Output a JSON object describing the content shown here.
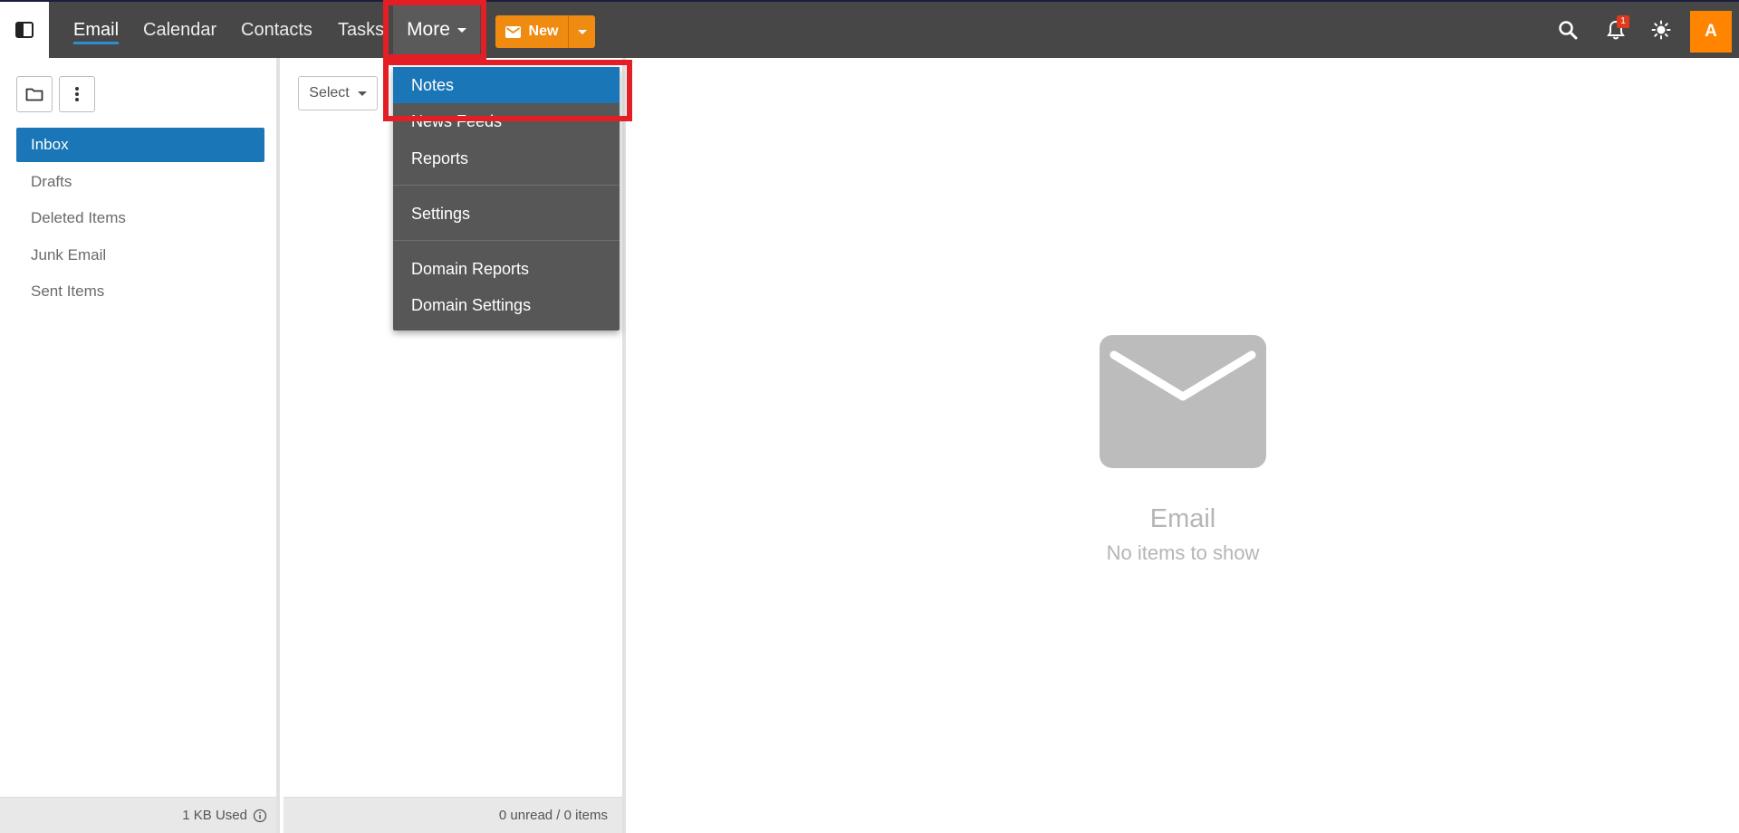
{
  "nav": {
    "tabs": [
      {
        "label": "Email",
        "active": true
      },
      {
        "label": "Calendar"
      },
      {
        "label": "Contacts"
      },
      {
        "label": "Tasks"
      }
    ],
    "more_label": "More",
    "new_label": "New",
    "notification_count": "1",
    "avatar_initial": "A",
    "icons": [
      "sidebar-toggle-icon",
      "search-icon",
      "bell-icon",
      "theme-sun-icon"
    ]
  },
  "more_menu": {
    "items": [
      "Notes",
      "News Feeds",
      "Reports",
      "Settings",
      "Domain Reports",
      "Domain Settings"
    ],
    "active_item": "Notes"
  },
  "folders": {
    "items": [
      "Inbox",
      "Drafts",
      "Deleted Items",
      "Junk Email",
      "Sent Items"
    ],
    "active": "Inbox",
    "footer": "1 KB Used"
  },
  "list": {
    "select_label": "Select",
    "footer": "0 unread / 0 items"
  },
  "reading_pane": {
    "title": "Email",
    "subtitle": "No items to show"
  },
  "colors": {
    "topbar": "#474747",
    "accent_blue": "#1a76b6",
    "new_button": "#ef8b10",
    "avatar": "#ff8400",
    "highlight": "#e31e24"
  }
}
